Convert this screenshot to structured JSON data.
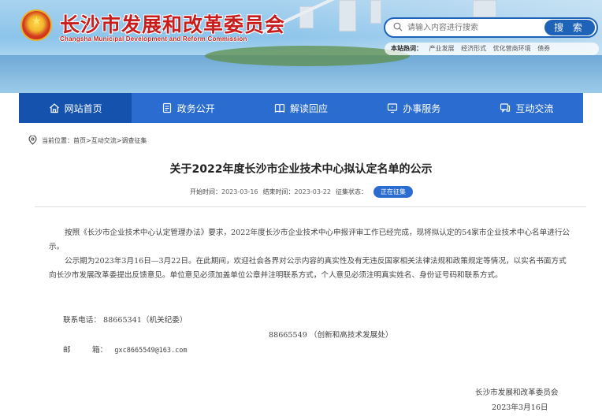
{
  "header": {
    "title": "长沙市发展和改革委员会",
    "subtitle": "Changsha Municipal Development and Reform Commission",
    "search": {
      "placeholder": "请输入内容进行搜索",
      "button": "搜 索"
    },
    "hot": {
      "label": "本站热词：",
      "keywords": [
        "产业发展",
        "经济形式",
        "优化营商环境",
        "债券"
      ]
    }
  },
  "nav": {
    "items": [
      {
        "label": "网站首页",
        "icon": "home-icon",
        "active": true
      },
      {
        "label": "政务公开",
        "icon": "document-icon"
      },
      {
        "label": "解读回应",
        "icon": "book-icon"
      },
      {
        "label": "办事服务",
        "icon": "monitor-icon"
      },
      {
        "label": "互动交流",
        "icon": "chat-icon"
      }
    ]
  },
  "breadcrumb": "当前位置：首页>互动交流>调查征集",
  "article": {
    "title": "关于2022年度长沙市企业技术中心拟认定名单的公示",
    "meta": {
      "start_label": "开始时间：",
      "start": "2023-03-16",
      "end_label": "结束时间：",
      "end": "2023-03-22",
      "status_label": "征集状态：",
      "status": "正在征集"
    },
    "paragraphs": [
      "按照《长沙市企业技术中心认定管理办法》要求，2022年度长沙市企业技术中心申报评审工作已经完成，现将拟认定的54家市企业技术中心名单进行公示。",
      "公示期为2023年3月16日—3月22日。在此期间，欢迎社会各界对公示内容的真实性及有无违反国家相关法律法规和政策规定等情况，以实名书面方式向长沙市发展改革委提出反馈意见。单位意见必须加盖单位公章并注明联系方式，个人意见必须注明真实姓名、身份证号码和联系方式。"
    ],
    "contact": {
      "phone_label": "联系电话：",
      "phone1": "88665341（机关纪委）",
      "phone2": "88665549 （创新和高技术发展处）",
      "email_label": "邮         箱：",
      "email": "gxc8665549@163.com"
    },
    "signature": {
      "org": "长沙市发展和改革委员会",
      "date": "2023年3月16日"
    }
  }
}
